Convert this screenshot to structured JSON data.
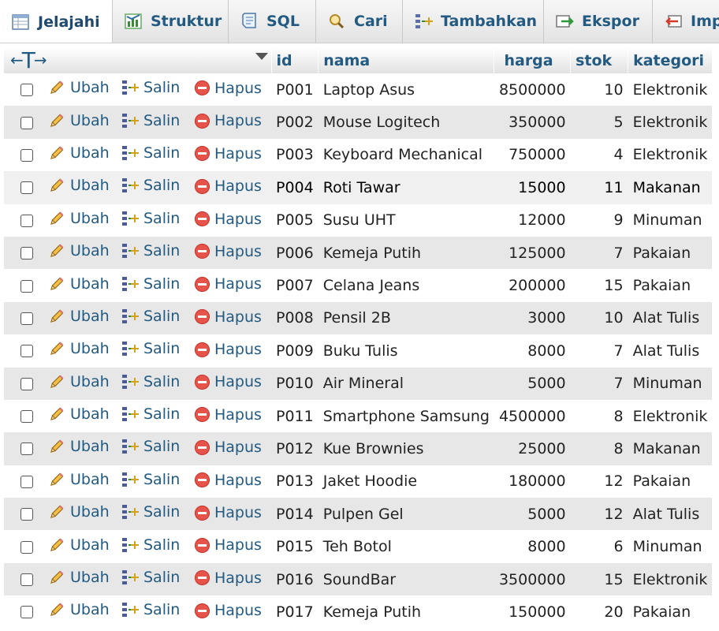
{
  "tabs": [
    {
      "label": "Jelajahi",
      "icon": "browse-icon",
      "active": true
    },
    {
      "label": "Struktur",
      "icon": "structure-icon"
    },
    {
      "label": "SQL",
      "icon": "sql-icon"
    },
    {
      "label": "Cari",
      "icon": "search-icon"
    },
    {
      "label": "Tambahkan",
      "icon": "insert-icon"
    },
    {
      "label": "Ekspor",
      "icon": "export-icon"
    },
    {
      "label": "Import",
      "icon": "import-icon"
    }
  ],
  "table": {
    "columns": [
      "id",
      "nama",
      "harga",
      "stok",
      "kategori"
    ],
    "actions": {
      "edit": "Ubah",
      "copy": "Salin",
      "delete": "Hapus"
    },
    "rows": [
      {
        "id": "P001",
        "nama": "Laptop Asus",
        "harga": "8500000",
        "stok": "10",
        "kategori": "Elektronik"
      },
      {
        "id": "P002",
        "nama": "Mouse Logitech",
        "harga": "350000",
        "stok": "5",
        "kategori": "Elektronik"
      },
      {
        "id": "P003",
        "nama": "Keyboard Mechanical",
        "harga": "750000",
        "stok": "4",
        "kategori": "Elektronik"
      },
      {
        "id": "P004",
        "nama": "Roti Tawar",
        "harga": "15000",
        "stok": "11",
        "kategori": "Makanan"
      },
      {
        "id": "P005",
        "nama": "Susu UHT",
        "harga": "12000",
        "stok": "9",
        "kategori": "Minuman"
      },
      {
        "id": "P006",
        "nama": "Kemeja Putih",
        "harga": "125000",
        "stok": "7",
        "kategori": "Pakaian"
      },
      {
        "id": "P007",
        "nama": "Celana Jeans",
        "harga": "200000",
        "stok": "15",
        "kategori": "Pakaian"
      },
      {
        "id": "P008",
        "nama": "Pensil 2B",
        "harga": "3000",
        "stok": "10",
        "kategori": "Alat Tulis"
      },
      {
        "id": "P009",
        "nama": "Buku Tulis",
        "harga": "8000",
        "stok": "7",
        "kategori": "Alat Tulis"
      },
      {
        "id": "P010",
        "nama": "Air Mineral",
        "harga": "5000",
        "stok": "7",
        "kategori": "Minuman"
      },
      {
        "id": "P011",
        "nama": "Smartphone Samsung",
        "harga": "4500000",
        "stok": "8",
        "kategori": "Elektronik"
      },
      {
        "id": "P012",
        "nama": "Kue Brownies",
        "harga": "25000",
        "stok": "8",
        "kategori": "Makanan"
      },
      {
        "id": "P013",
        "nama": "Jaket Hoodie",
        "harga": "180000",
        "stok": "12",
        "kategori": "Pakaian"
      },
      {
        "id": "P014",
        "nama": "Pulpen Gel",
        "harga": "5000",
        "stok": "12",
        "kategori": "Alat Tulis"
      },
      {
        "id": "P015",
        "nama": "Teh Botol",
        "harga": "8000",
        "stok": "6",
        "kategori": "Minuman"
      },
      {
        "id": "P016",
        "nama": "SoundBar",
        "harga": "3500000",
        "stok": "15",
        "kategori": "Elektronik"
      },
      {
        "id": "P017",
        "nama": "Kemeja Putih",
        "harga": "150000",
        "stok": "20",
        "kategori": "Pakaian"
      }
    ]
  },
  "colors": {
    "link": "#235a81",
    "delete": "#e5534b",
    "row_alt": "#e7e7e7"
  }
}
